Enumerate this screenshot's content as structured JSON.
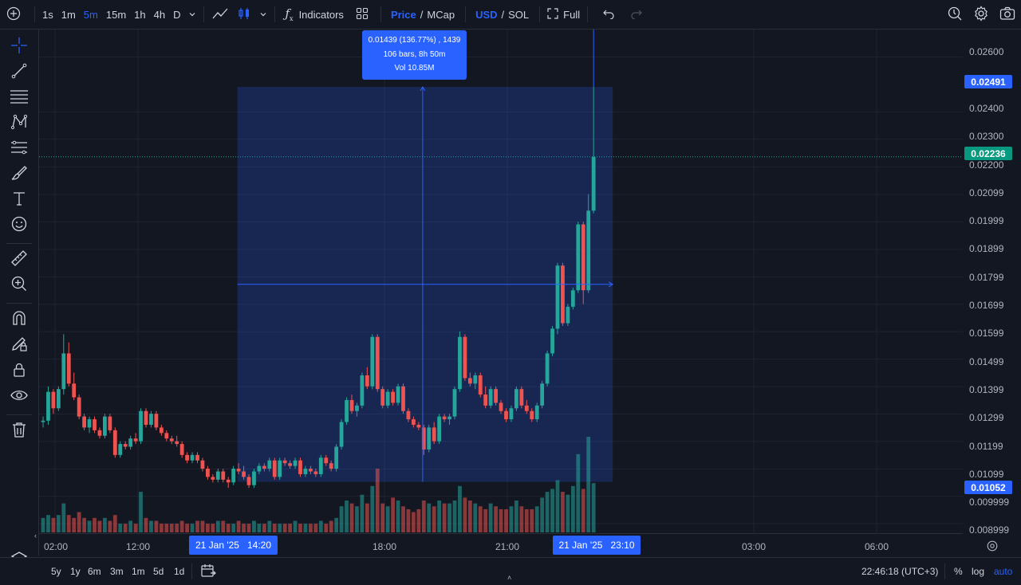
{
  "toolbar": {
    "intervals": [
      "1s",
      "1m",
      "5m",
      "15m",
      "1h",
      "4h",
      "D"
    ],
    "active_interval": "5m",
    "indicators_label": "Indicators",
    "price_label": "Price",
    "slash1": "/",
    "mcap_label": "MCap",
    "usd_label": "USD",
    "slash2": "/",
    "sol_label": "SOL",
    "full_label": "Full"
  },
  "measure_tooltip": {
    "line1": "0.01439 (136.77%) , 1439",
    "line2": "106 bars, 8h 50m",
    "line3": "Vol 10.85M"
  },
  "price_axis": {
    "labels": [
      "0.02600",
      "0.02400",
      "0.02300",
      "0.02200",
      "0.02099",
      "0.01999",
      "0.01899",
      "0.01799",
      "0.01699",
      "0.01599",
      "0.01499",
      "0.01399",
      "0.01299",
      "0.01199",
      "0.01099",
      "0.009999",
      "0.008999"
    ],
    "tag_high": "0.02491",
    "tag_current": "0.02236",
    "tag_low": "0.01052",
    "colors": {
      "high_tag": "#2962ff",
      "current_tag": "#089981",
      "low_tag": "#2962ff"
    }
  },
  "time_axis": {
    "labels": [
      "02:00",
      "12:00",
      "18:00",
      "21:00",
      "03:00",
      "06:00"
    ],
    "range_start": "21 Jan '25   14:20",
    "range_end": "21 Jan '25   23:10"
  },
  "bottombar": {
    "ranges": [
      "5y",
      "1y",
      "6m",
      "3m",
      "1m",
      "5d",
      "1d"
    ],
    "clock": "22:46:18 (UTC+3)",
    "percent_label": "%",
    "log_label": "log",
    "auto_label": "auto"
  },
  "chart_data": {
    "type": "candlestick",
    "up_color": "#26a69a",
    "down_color": "#ef5350",
    "measure_color": "#2962ff",
    "ylim": [
      0.00865,
      0.027
    ],
    "price_ticks": [
      0.026,
      0.024,
      0.023,
      0.022,
      0.02099,
      0.01999,
      0.01899,
      0.01799,
      0.01699,
      0.01599,
      0.01499,
      0.01399,
      0.01299,
      0.01199,
      0.01099,
      0.009999,
      0.008999
    ],
    "measure_range": {
      "from_price": 0.01052,
      "to_price": 0.02491
    },
    "current_price": 0.02236,
    "candles": [
      [
        0.0127,
        0.0129,
        0.0125,
        0.01275
      ],
      [
        0.01275,
        0.014,
        0.0126,
        0.0138
      ],
      [
        0.0138,
        0.0139,
        0.013,
        0.0132
      ],
      [
        0.0132,
        0.014,
        0.0131,
        0.0139
      ],
      [
        0.0139,
        0.0159,
        0.0137,
        0.0152
      ],
      [
        0.0152,
        0.0156,
        0.014,
        0.0141
      ],
      [
        0.0141,
        0.0145,
        0.0135,
        0.0136
      ],
      [
        0.0136,
        0.0137,
        0.0128,
        0.0129
      ],
      [
        0.0129,
        0.013,
        0.0124,
        0.0125
      ],
      [
        0.0125,
        0.0129,
        0.0123,
        0.0128
      ],
      [
        0.0128,
        0.0129,
        0.0123,
        0.0124
      ],
      [
        0.0124,
        0.0125,
        0.0121,
        0.0122
      ],
      [
        0.0122,
        0.013,
        0.0121,
        0.0129
      ],
      [
        0.0129,
        0.013,
        0.0123,
        0.0124
      ],
      [
        0.0124,
        0.0125,
        0.0114,
        0.0115
      ],
      [
        0.0115,
        0.012,
        0.0114,
        0.0119
      ],
      [
        0.0119,
        0.012,
        0.0117,
        0.0118
      ],
      [
        0.0118,
        0.0122,
        0.0117,
        0.0121
      ],
      [
        0.0121,
        0.0123,
        0.0119,
        0.012
      ],
      [
        0.012,
        0.0132,
        0.0119,
        0.0131
      ],
      [
        0.0131,
        0.0132,
        0.0125,
        0.0126
      ],
      [
        0.0126,
        0.0131,
        0.0125,
        0.013
      ],
      [
        0.013,
        0.0131,
        0.0124,
        0.0125
      ],
      [
        0.0125,
        0.0126,
        0.0122,
        0.0123
      ],
      [
        0.0123,
        0.0124,
        0.012,
        0.0121
      ],
      [
        0.0121,
        0.0122,
        0.0119,
        0.012
      ],
      [
        0.012,
        0.0122,
        0.0118,
        0.0119
      ],
      [
        0.0119,
        0.012,
        0.0114,
        0.0115
      ],
      [
        0.0115,
        0.0116,
        0.0112,
        0.0113
      ],
      [
        0.0113,
        0.0116,
        0.0112,
        0.0115
      ],
      [
        0.0115,
        0.0116,
        0.0112,
        0.0113
      ],
      [
        0.0113,
        0.0114,
        0.0109,
        0.011
      ],
      [
        0.011,
        0.0111,
        0.0106,
        0.0107
      ],
      [
        0.0107,
        0.0108,
        0.0105,
        0.0106
      ],
      [
        0.0106,
        0.011,
        0.0105,
        0.0109
      ],
      [
        0.0109,
        0.011,
        0.0105,
        0.0106
      ],
      [
        0.0106,
        0.0107,
        0.0103,
        0.0105
      ],
      [
        0.0105,
        0.0111,
        0.0104,
        0.011
      ],
      [
        0.011,
        0.0112,
        0.0108,
        0.0109
      ],
      [
        0.0109,
        0.0111,
        0.0106,
        0.0107
      ],
      [
        0.0107,
        0.0108,
        0.0103,
        0.0104
      ],
      [
        0.0104,
        0.011,
        0.0103,
        0.0109
      ],
      [
        0.0109,
        0.0112,
        0.0108,
        0.0111
      ],
      [
        0.0111,
        0.0112,
        0.0109,
        0.011
      ],
      [
        0.011,
        0.0114,
        0.0109,
        0.0113
      ],
      [
        0.0113,
        0.0114,
        0.0106,
        0.0107
      ],
      [
        0.0107,
        0.0114,
        0.0106,
        0.0113
      ],
      [
        0.0113,
        0.0114,
        0.0111,
        0.0112
      ],
      [
        0.0112,
        0.0113,
        0.011,
        0.0111
      ],
      [
        0.0111,
        0.0114,
        0.011,
        0.0113
      ],
      [
        0.0113,
        0.0114,
        0.0107,
        0.0108
      ],
      [
        0.0108,
        0.0111,
        0.0107,
        0.011
      ],
      [
        0.011,
        0.0111,
        0.0108,
        0.0109
      ],
      [
        0.0109,
        0.011,
        0.0107,
        0.0108
      ],
      [
        0.0108,
        0.0115,
        0.0107,
        0.0114
      ],
      [
        0.0114,
        0.0115,
        0.0111,
        0.0112
      ],
      [
        0.0112,
        0.0113,
        0.0109,
        0.011
      ],
      [
        0.011,
        0.0119,
        0.0109,
        0.0118
      ],
      [
        0.0118,
        0.0128,
        0.0117,
        0.0127
      ],
      [
        0.0127,
        0.0136,
        0.0126,
        0.0135
      ],
      [
        0.0135,
        0.0137,
        0.013,
        0.0131
      ],
      [
        0.0131,
        0.0134,
        0.0129,
        0.0133
      ],
      [
        0.0133,
        0.0145,
        0.0132,
        0.0144
      ],
      [
        0.0144,
        0.0147,
        0.0139,
        0.014
      ],
      [
        0.014,
        0.0159,
        0.0139,
        0.0158
      ],
      [
        0.0158,
        0.0159,
        0.0138,
        0.0139
      ],
      [
        0.0139,
        0.014,
        0.0132,
        0.0133
      ],
      [
        0.0133,
        0.0139,
        0.0132,
        0.0138
      ],
      [
        0.0138,
        0.0139,
        0.0133,
        0.0134
      ],
      [
        0.0134,
        0.0141,
        0.0133,
        0.014
      ],
      [
        0.014,
        0.0141,
        0.013,
        0.0131
      ],
      [
        0.0131,
        0.0132,
        0.0127,
        0.0128
      ],
      [
        0.0128,
        0.0129,
        0.0125,
        0.0126
      ],
      [
        0.0126,
        0.0127,
        0.0124,
        0.0125
      ],
      [
        0.0125,
        0.0126,
        0.0115,
        0.0117
      ],
      [
        0.0117,
        0.0126,
        0.0116,
        0.0125
      ],
      [
        0.0125,
        0.0127,
        0.0119,
        0.012
      ],
      [
        0.012,
        0.013,
        0.0119,
        0.0129
      ],
      [
        0.0129,
        0.013,
        0.0127,
        0.0128
      ],
      [
        0.0128,
        0.013,
        0.0126,
        0.0129
      ],
      [
        0.0129,
        0.014,
        0.0128,
        0.0139
      ],
      [
        0.0139,
        0.016,
        0.0138,
        0.0158
      ],
      [
        0.0158,
        0.0159,
        0.0142,
        0.0143
      ],
      [
        0.0143,
        0.0145,
        0.014,
        0.0141
      ],
      [
        0.0141,
        0.0145,
        0.0139,
        0.0144
      ],
      [
        0.0144,
        0.0145,
        0.0136,
        0.0137
      ],
      [
        0.0137,
        0.014,
        0.0132,
        0.0133
      ],
      [
        0.0133,
        0.014,
        0.0132,
        0.0139
      ],
      [
        0.0139,
        0.014,
        0.0133,
        0.0134
      ],
      [
        0.0134,
        0.0135,
        0.013,
        0.0131
      ],
      [
        0.0131,
        0.0132,
        0.0127,
        0.0128
      ],
      [
        0.0128,
        0.0133,
        0.0127,
        0.0132
      ],
      [
        0.0132,
        0.014,
        0.0131,
        0.0139
      ],
      [
        0.0139,
        0.014,
        0.0132,
        0.0133
      ],
      [
        0.0133,
        0.0135,
        0.013,
        0.0131
      ],
      [
        0.0131,
        0.0132,
        0.0127,
        0.0128
      ],
      [
        0.0128,
        0.0134,
        0.0127,
        0.0133
      ],
      [
        0.0133,
        0.0142,
        0.0132,
        0.0141
      ],
      [
        0.0141,
        0.0153,
        0.014,
        0.0152
      ],
      [
        0.0152,
        0.0162,
        0.0151,
        0.0161
      ],
      [
        0.0161,
        0.0185,
        0.0159,
        0.0184
      ],
      [
        0.0184,
        0.0185,
        0.0162,
        0.0163
      ],
      [
        0.0163,
        0.017,
        0.0162,
        0.0169
      ],
      [
        0.0169,
        0.0176,
        0.0168,
        0.0175
      ],
      [
        0.0175,
        0.02,
        0.0174,
        0.0199
      ],
      [
        0.0199,
        0.02,
        0.017,
        0.0175
      ],
      [
        0.0175,
        0.021,
        0.0174,
        0.0204
      ],
      [
        0.0204,
        0.02491,
        0.0203,
        0.02236
      ]
    ],
    "volumes": [
      5,
      6,
      5,
      6,
      10,
      6,
      5,
      7,
      5,
      4,
      5,
      4,
      5,
      4,
      6,
      3,
      3,
      4,
      3,
      14,
      5,
      4,
      4,
      3,
      3,
      3,
      3,
      4,
      3,
      3,
      4,
      4,
      3,
      3,
      4,
      4,
      3,
      3,
      4,
      3,
      3,
      4,
      3,
      3,
      4,
      3,
      3,
      3,
      3,
      4,
      3,
      3,
      3,
      3,
      4,
      3,
      4,
      5,
      9,
      11,
      10,
      9,
      13,
      10,
      16,
      22,
      10,
      9,
      12,
      11,
      9,
      8,
      7,
      8,
      11,
      10,
      9,
      11,
      10,
      10,
      11,
      16,
      12,
      11,
      10,
      9,
      8,
      10,
      9,
      8,
      8,
      9,
      11,
      9,
      8,
      8,
      9,
      12,
      14,
      15,
      18,
      14,
      13,
      16,
      27,
      15,
      33,
      17
    ]
  }
}
